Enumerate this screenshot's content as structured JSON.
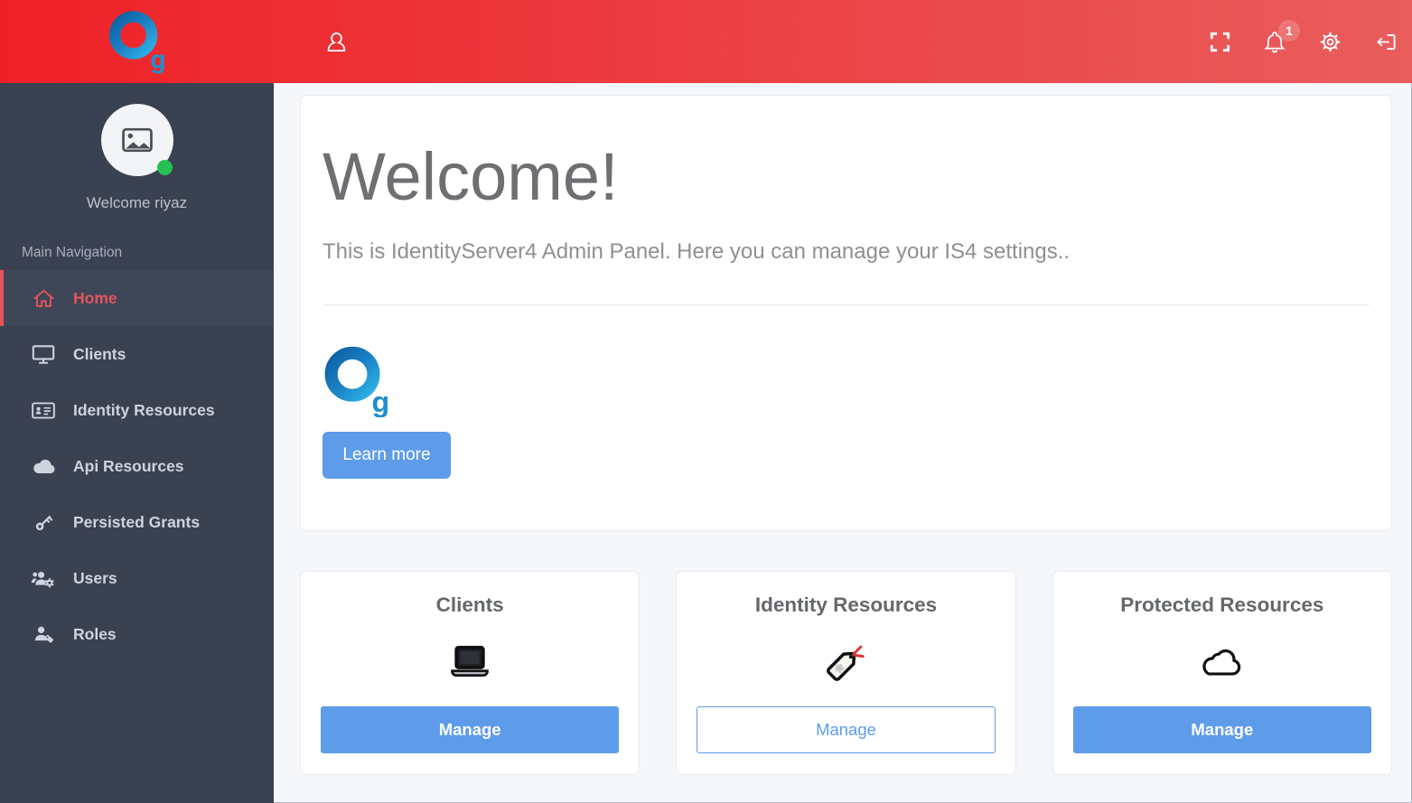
{
  "topbar": {
    "logo_letter": "g",
    "notifications_badge": "1",
    "icons": [
      "user-icon",
      "fullscreen-icon",
      "bell-icon",
      "gear-icon",
      "logout-icon"
    ]
  },
  "sidebar": {
    "welcome_text": "Welcome riyaz",
    "section_label": "Main Navigation",
    "items": [
      {
        "label": "Home",
        "icon": "home-icon",
        "active": true
      },
      {
        "label": "Clients",
        "icon": "desktop-icon",
        "active": false
      },
      {
        "label": "Identity Resources",
        "icon": "id-card-icon",
        "active": false
      },
      {
        "label": "Api Resources",
        "icon": "cloud-icon",
        "active": false
      },
      {
        "label": "Persisted Grants",
        "icon": "key-icon",
        "active": false
      },
      {
        "label": "Users",
        "icon": "users-gear-icon",
        "active": false
      },
      {
        "label": "Roles",
        "icon": "user-tag-icon",
        "active": false
      }
    ]
  },
  "main": {
    "welcome": {
      "title": "Welcome!",
      "subtitle": "This is IdentityServer4 Admin Panel. Here you can manage your IS4 settings..",
      "button_label": "Learn more"
    },
    "cards": [
      {
        "title": "Clients",
        "icon": "laptop-icon",
        "button_label": "Manage",
        "variant": "solid"
      },
      {
        "title": "Identity Resources",
        "icon": "tag-icon",
        "button_label": "Manage",
        "variant": "outline"
      },
      {
        "title": "Protected Resources",
        "icon": "cloud-outline-icon",
        "button_label": "Manage",
        "variant": "solid"
      }
    ]
  },
  "colors": {
    "topbar_gradient_start": "#ee2127",
    "topbar_gradient_end": "#e95d5d",
    "sidebar_bg": "#3a4151",
    "sidebar_active_bg": "#3f4657",
    "active_red": "#e4555c",
    "accent_blue": "#5e9cea",
    "status_green": "#25c152",
    "main_bg": "#f5f7fa"
  }
}
